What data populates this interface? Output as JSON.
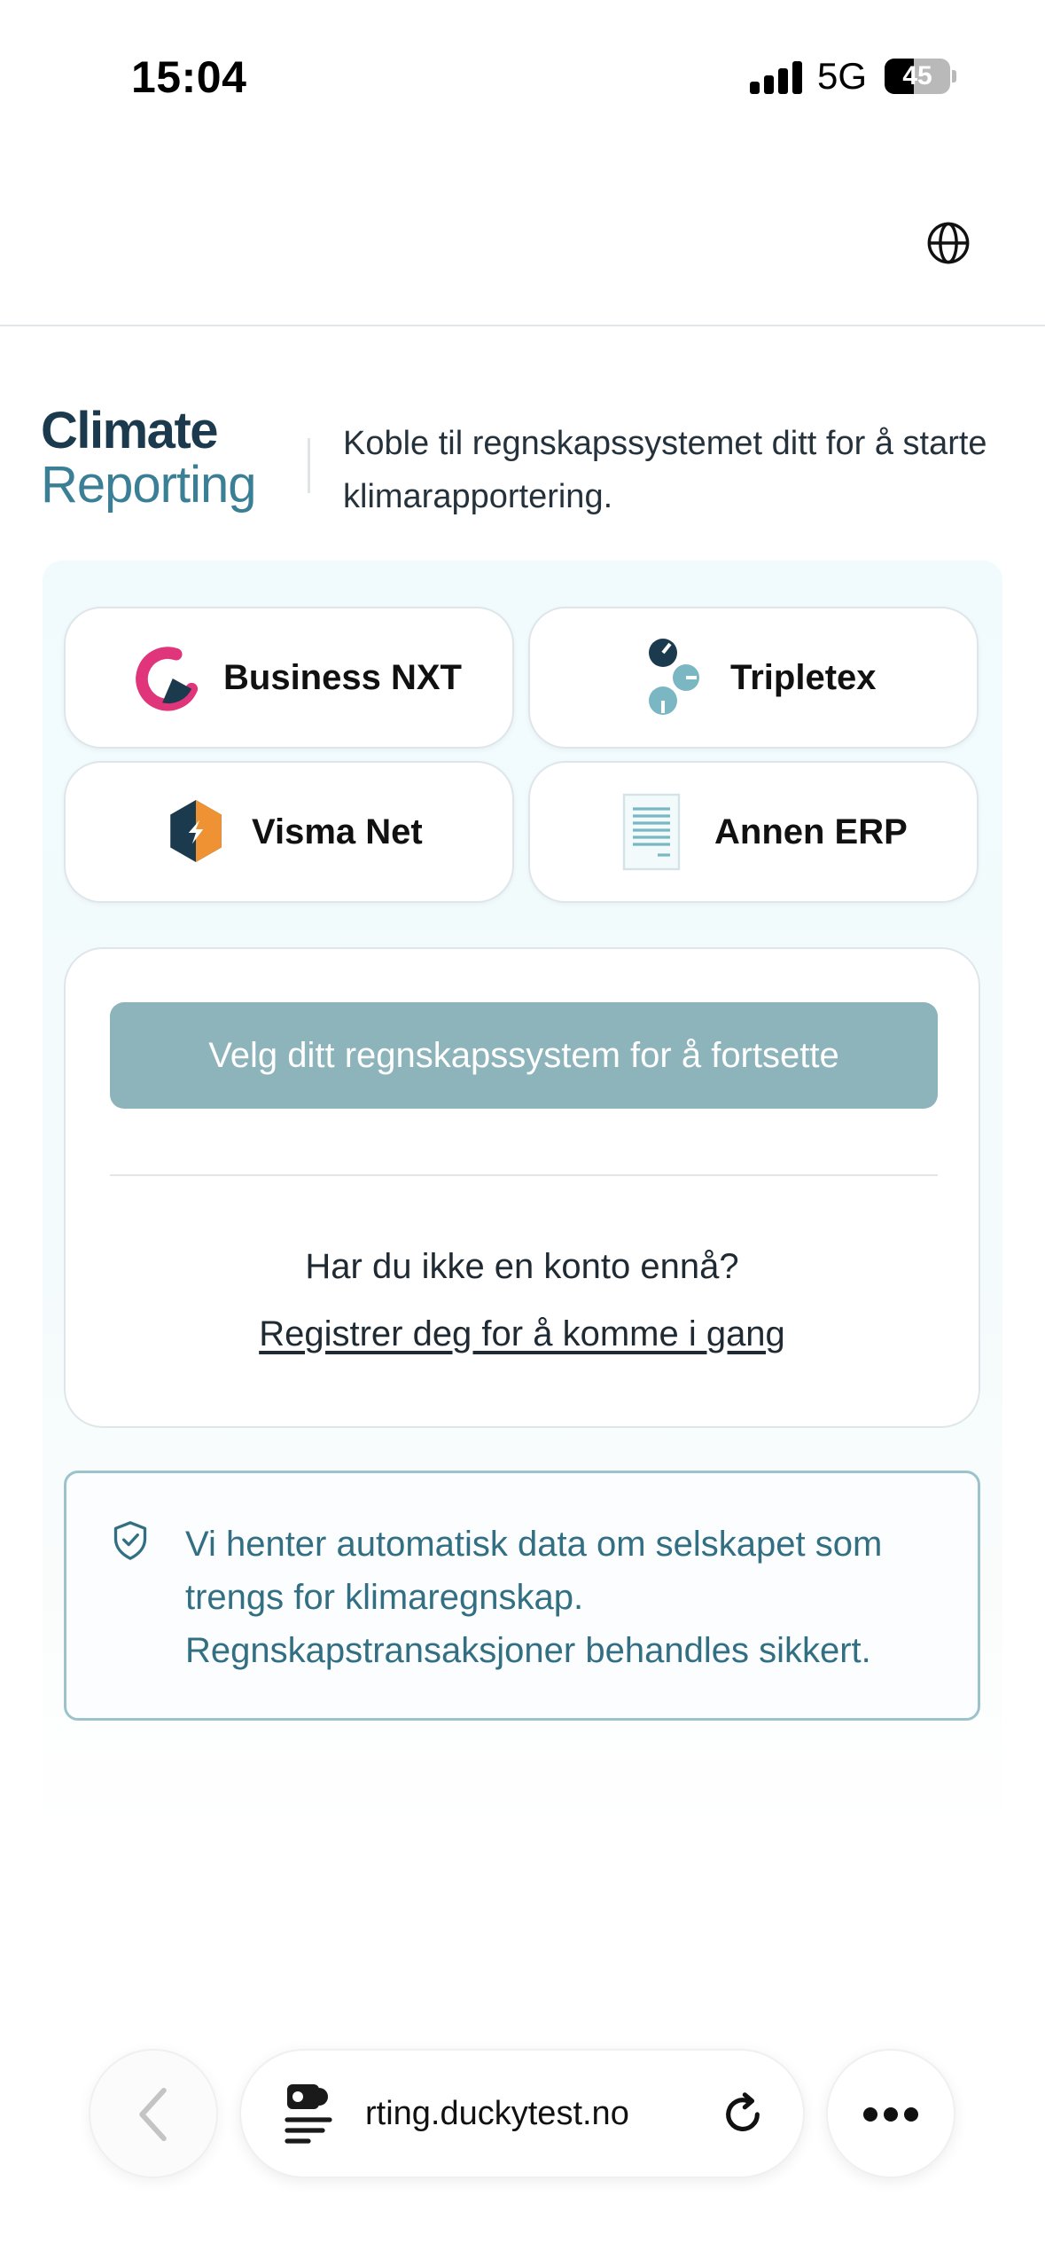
{
  "status_bar": {
    "time": "15:04",
    "network": "5G",
    "battery_level": "45",
    "battery_fraction": 0.45
  },
  "header": {
    "language_icon": "globe-icon"
  },
  "hero": {
    "brand_line1": "Climate",
    "brand_line2": "Reporting",
    "description": "Koble til regnskapssystemet ditt for å starte klimarapportering."
  },
  "erp_options": [
    {
      "name": "Business NXT",
      "icon": "business-nxt-logo"
    },
    {
      "name": "Tripletex",
      "icon": "tripletex-logo"
    },
    {
      "name": "Visma Net",
      "icon": "visma-net-logo"
    },
    {
      "name": "Annen ERP",
      "icon": "document-icon"
    }
  ],
  "login": {
    "cta_label": "Velg ditt regnskapssystem for å fortsette",
    "no_account_text": "Har du ikke en konto ennå?",
    "register_link": "Registrer deg for å komme i gang"
  },
  "info": {
    "icon": "shield-check-icon",
    "text": "Vi henter automatisk data om selskapet som trengs for klimaregnskap. Regnskapstransaksjoner behandles sikkert."
  },
  "browser_bar": {
    "url": "rting.duckytest.no",
    "back_icon": "chevron-left-icon",
    "page_icon": "page-settings-icon",
    "reload_icon": "reload-icon",
    "more_icon": "more-icon"
  },
  "colors": {
    "brand_dark": "#1c3a4e",
    "brand_teal": "#3b7f96",
    "cta_disabled": "#8db4bb",
    "info_border": "#9cc2cb",
    "info_text": "#336f83",
    "panel_bg": "#f1fbfd"
  }
}
